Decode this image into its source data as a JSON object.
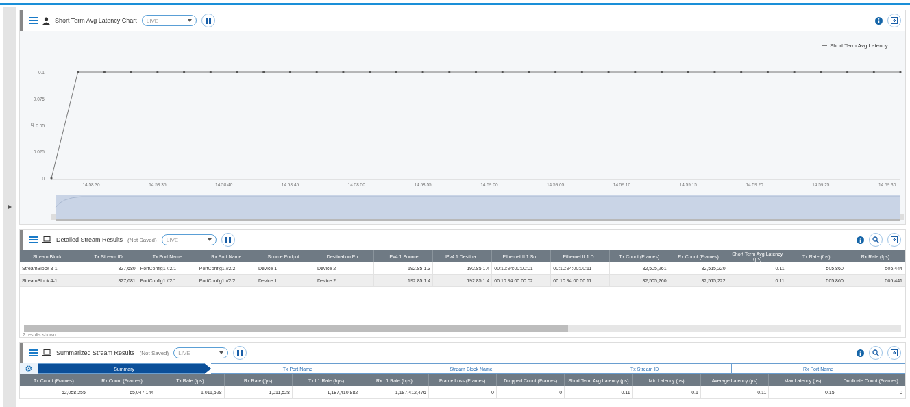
{
  "chart_panel": {
    "title": "Short Term Avg Latency Chart",
    "mode": "LIVE",
    "chart_data": {
      "type": "line",
      "ylabel": "µs",
      "ylim": [
        0,
        0.1
      ],
      "xlim": [
        53907,
        53971
      ],
      "yticks": [
        0,
        0.025,
        0.05,
        0.075,
        0.1
      ],
      "xticks": [
        {
          "value": 53910,
          "label": "14:58:30"
        },
        {
          "value": 53915,
          "label": "14:58:35"
        },
        {
          "value": 53920,
          "label": "14:58:40"
        },
        {
          "value": 53925,
          "label": "14:58:45"
        },
        {
          "value": 53930,
          "label": "14:58:50"
        },
        {
          "value": 53935,
          "label": "14:58:55"
        },
        {
          "value": 53940,
          "label": "14:59:00"
        },
        {
          "value": 53945,
          "label": "14:59:05"
        },
        {
          "value": 53950,
          "label": "14:59:10"
        },
        {
          "value": 53955,
          "label": "14:59:15"
        },
        {
          "value": 53960,
          "label": "14:59:20"
        },
        {
          "value": 53965,
          "label": "14:59:25"
        },
        {
          "value": 53970,
          "label": "14:59:30"
        }
      ],
      "x": [
        53907,
        53909,
        53911,
        53913,
        53915,
        53917,
        53919,
        53921,
        53923,
        53925,
        53927,
        53929,
        53931,
        53933,
        53935,
        53937,
        53939,
        53941,
        53943,
        53945,
        53947,
        53949,
        53951,
        53953,
        53955,
        53957,
        53959,
        53961,
        53963,
        53965,
        53967,
        53969,
        53971
      ],
      "series": [
        {
          "name": "Short Term Avg Latency",
          "color": "#555555",
          "values": [
            0,
            0.1,
            0.1,
            0.1,
            0.1,
            0.1,
            0.1,
            0.1,
            0.1,
            0.1,
            0.1,
            0.1,
            0.1,
            0.1,
            0.1,
            0.1,
            0.1,
            0.1,
            0.1,
            0.1,
            0.1,
            0.1,
            0.1,
            0.1,
            0.1,
            0.1,
            0.1,
            0.1,
            0.1,
            0.1,
            0.1,
            0.1,
            0.1
          ]
        }
      ]
    }
  },
  "detail_panel": {
    "title": "Detailed Stream Results",
    "note": "(Not Saved)",
    "mode": "LIVE",
    "columns": [
      "Stream Block...",
      "Tx Stream ID",
      "Tx Port Name",
      "Rx Port Name",
      "Source Endpoi...",
      "Destination En...",
      "IPv4 1 Source",
      "IPv4 1 Destina...",
      "Ethernet II 1 So...",
      "Ethernet II 1 D...",
      "Tx Count (Frames)",
      "Rx Count (Frames)",
      "Short Term Avg Latency (µs)",
      "Tx Rate (fps)",
      "Rx Rate (fps)"
    ],
    "rows": [
      [
        "StreamBlock 3-1",
        "327,680",
        "PortConfig1 //2/1",
        "PortConfig1 //2/2",
        "Device 1",
        "Device 2",
        "192.85.1.3",
        "192.85.1.4",
        "00:10:94:00:00:01",
        "00:10:94:00:00:11",
        "32,505,261",
        "32,515,220",
        "0.11",
        "505,860",
        "505,444"
      ],
      [
        "StreamBlock 4-1",
        "327,681",
        "PortConfig1 //2/1",
        "PortConfig1 //2/2",
        "Device 1",
        "Device 2",
        "192.85.1.4",
        "192.85.1.4",
        "00:10:94:00:00:02",
        "00:10:94:00:00:11",
        "32,505,260",
        "32,515,222",
        "0.11",
        "505,860",
        "505,441"
      ]
    ],
    "footer": "2 results shown"
  },
  "summary_panel": {
    "title": "Summarized Stream Results",
    "note": "(Not Saved)",
    "mode": "LIVE",
    "tabs": [
      {
        "label": "Summary",
        "selected": true
      },
      {
        "label": "Tx Port Name",
        "selected": false
      },
      {
        "label": "Stream Block Name",
        "selected": false
      },
      {
        "label": "Tx Stream ID",
        "selected": false
      },
      {
        "label": "Rx Port Name",
        "selected": false
      }
    ],
    "columns": [
      "Tx Count (Frames)",
      "Rx Count (Frames)",
      "Tx Rate (fps)",
      "Rx Rate (fps)",
      "Tx L1 Rate (bps)",
      "Rx L1 Rate (bps)",
      "Frame Loss (Frames)",
      "Dropped Count (Frames)",
      "Short Term Avg Latency (µs)",
      "Min Latency (µs)",
      "Average Latency (µs)",
      "Max Latency (µs)",
      "Duplicate Count (Frames)"
    ],
    "rows": [
      [
        "62,058,255",
        "65,047,144",
        "1,011,528",
        "1,011,528",
        "1,187,410,882",
        "1,187,412,476",
        "0",
        "0",
        "0.11",
        "0.1",
        "0.11",
        "0.15",
        "0"
      ]
    ]
  }
}
